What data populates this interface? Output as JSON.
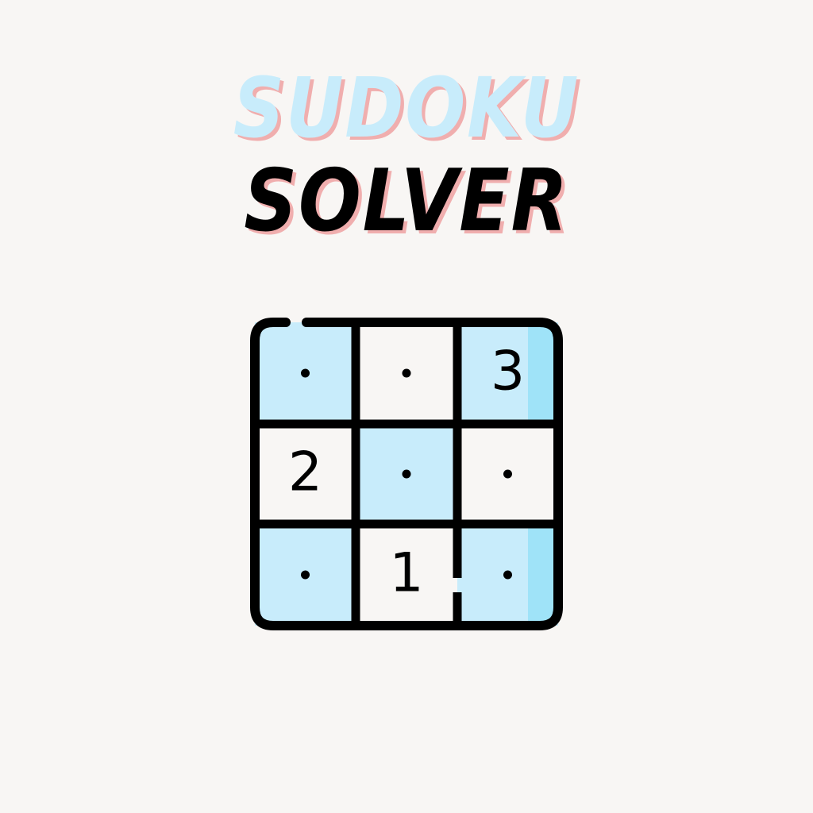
{
  "title": {
    "line1": "SUDOKU",
    "line2": "SOLVER"
  },
  "colors": {
    "background": "#f8f6f4",
    "title_line1": "#c8ecfb",
    "title_shadow": "#f0aeae",
    "title_line2": "#000000",
    "cell_blue": "#c8ecfb",
    "cell_blue_edge": "#9fe3f8",
    "cell_white": "#f8f6f4",
    "grid_line": "#000000"
  },
  "icon": "sudoku-grid-icon",
  "grid": {
    "cells": [
      {
        "digit": "",
        "shade": "blue"
      },
      {
        "digit": "",
        "shade": "white"
      },
      {
        "digit": "3",
        "shade": "blue"
      },
      {
        "digit": "2",
        "shade": "white"
      },
      {
        "digit": "",
        "shade": "blue"
      },
      {
        "digit": "",
        "shade": "white"
      },
      {
        "digit": "",
        "shade": "blue"
      },
      {
        "digit": "1",
        "shade": "white"
      },
      {
        "digit": "",
        "shade": "blue"
      }
    ]
  }
}
